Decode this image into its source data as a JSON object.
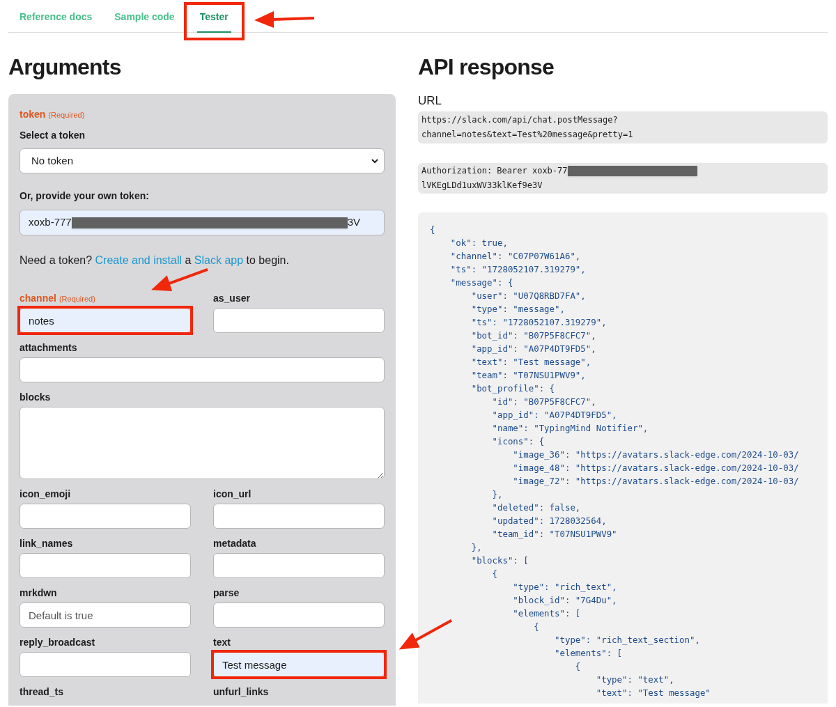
{
  "tabs": [
    {
      "label": "Reference docs",
      "selected": false,
      "highlighted": false
    },
    {
      "label": "Sample code",
      "selected": false,
      "highlighted": false
    },
    {
      "label": "Tester",
      "selected": true,
      "highlighted": true
    }
  ],
  "arguments": {
    "heading": "Arguments",
    "token": {
      "label": "token",
      "required_note": "(Required)",
      "select_label": "Select a token",
      "select_value": "No token",
      "own_label": "Or, provide your own token:",
      "value_start": "xoxb-777",
      "value_end": "3V",
      "redacted": true
    },
    "help": [
      {
        "kind": "text",
        "text": "Need a token? "
      },
      {
        "kind": "link",
        "text": "Create and install"
      },
      {
        "kind": "text",
        "text": " a "
      },
      {
        "kind": "link",
        "text": "Slack app"
      },
      {
        "kind": "text",
        "text": " to begin."
      }
    ],
    "fields": [
      {
        "label": "channel",
        "required_note": "(Required)",
        "kind": "input",
        "value": "notes",
        "highlighted": true
      },
      {
        "label": "as_user",
        "kind": "input",
        "highlighted": false
      },
      {
        "label": "attachments",
        "kind": "wide_input",
        "highlighted": false
      },
      {
        "label": "blocks",
        "kind": "textarea",
        "highlighted": false
      },
      {
        "label": "icon_emoji",
        "kind": "input",
        "highlighted": false
      },
      {
        "label": "icon_url",
        "kind": "input",
        "highlighted": false
      },
      {
        "label": "link_names",
        "kind": "input",
        "highlighted": false
      },
      {
        "label": "metadata",
        "kind": "input",
        "highlighted": false
      },
      {
        "label": "mrkdwn",
        "kind": "input",
        "placeholder": "Default is true",
        "highlighted": false
      },
      {
        "label": "parse",
        "kind": "input",
        "highlighted": false
      },
      {
        "label": "reply_broadcast",
        "kind": "input",
        "highlighted": false
      },
      {
        "label": "text",
        "kind": "input",
        "value": "Test message",
        "highlighted": true
      },
      {
        "label": "thread_ts",
        "kind": "label_only",
        "highlighted": false
      },
      {
        "label": "unfurl_links",
        "kind": "label_only",
        "highlighted": false
      }
    ]
  },
  "response": {
    "heading": "API response",
    "url_label": "URL",
    "url_lines": [
      "https://slack.com/api/chat.postMessage?",
      "channel=notes&text=Test%20message&pretty=1"
    ],
    "auth": {
      "line_start": "Authorization: Bearer xoxb-77",
      "redacted": true,
      "line_2": "lVKEgLDd1uxWV33klKef9e3V"
    },
    "body_lines": [
      "{",
      "    \"ok\": true,",
      "    \"channel\": \"C07P07W61A6\",",
      "    \"ts\": \"1728052107.319279\",",
      "    \"message\": {",
      "        \"user\": \"U07Q8RBD7FA\",",
      "        \"type\": \"message\",",
      "        \"ts\": \"1728052107.319279\",",
      "        \"bot_id\": \"B07P5F8CFC7\",",
      "        \"app_id\": \"A07P4DT9FD5\",",
      "        \"text\": \"Test message\",",
      "        \"team\": \"T07NSU1PWV9\",",
      "        \"bot_profile\": {",
      "            \"id\": \"B07P5F8CFC7\",",
      "            \"app_id\": \"A07P4DT9FD5\",",
      "            \"name\": \"TypingMind Notifier\",",
      "            \"icons\": {",
      "                \"image_36\": \"https://avatars.slack-edge.com/2024-10-03/",
      "                \"image_48\": \"https://avatars.slack-edge.com/2024-10-03/",
      "                \"image_72\": \"https://avatars.slack-edge.com/2024-10-03/",
      "            },",
      "            \"deleted\": false,",
      "            \"updated\": 1728032564,",
      "            \"team_id\": \"T07NSU1PWV9\"",
      "        },",
      "        \"blocks\": [",
      "            {",
      "                \"type\": \"rich_text\",",
      "                \"block_id\": \"7G4Du\",",
      "                \"elements\": [",
      "                    {",
      "                        \"type\": \"rich_text_section\",",
      "                        \"elements\": [",
      "                            {",
      "                                \"type\": \"text\",",
      "                                \"text\": \"Test message\""
    ]
  }
}
